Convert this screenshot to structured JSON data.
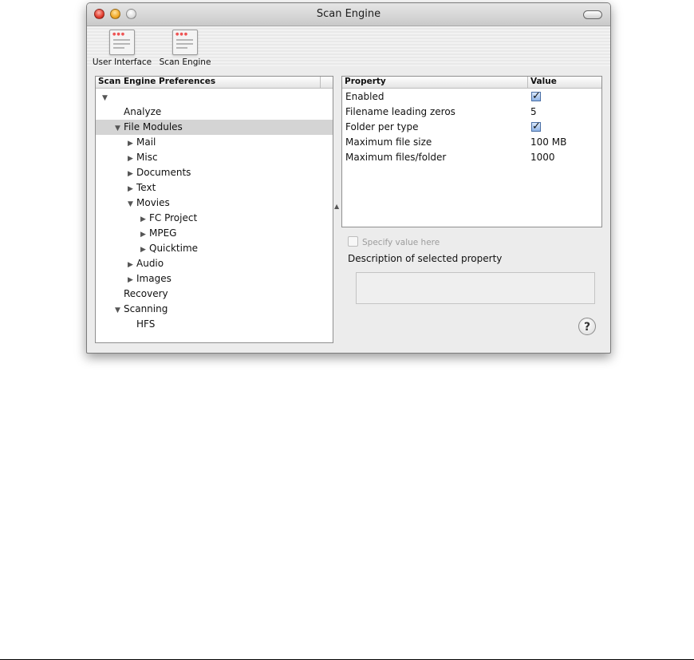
{
  "window": {
    "title": "Scan Engine"
  },
  "toolbar": {
    "items": [
      {
        "label": "User Interface",
        "icon": "window-prefs-icon"
      },
      {
        "label": "Scan Engine",
        "icon": "window-prefs-icon"
      }
    ]
  },
  "tree": {
    "header": "Scan Engine Preferences",
    "selected": "File Modules",
    "rows": [
      {
        "label": "",
        "expanded": true,
        "depth": 0
      },
      {
        "label": "Analyze",
        "depth": 1
      },
      {
        "label": "File Modules",
        "expanded": true,
        "depth": 1
      },
      {
        "label": "Mail",
        "expanded": false,
        "depth": 2
      },
      {
        "label": "Misc",
        "expanded": false,
        "depth": 2
      },
      {
        "label": "Documents",
        "expanded": false,
        "depth": 2
      },
      {
        "label": "Text",
        "expanded": false,
        "depth": 2
      },
      {
        "label": "Movies",
        "expanded": true,
        "depth": 2
      },
      {
        "label": "FC Project",
        "expanded": false,
        "depth": 3
      },
      {
        "label": "MPEG",
        "expanded": false,
        "depth": 3
      },
      {
        "label": "Quicktime",
        "expanded": false,
        "depth": 3
      },
      {
        "label": "Audio",
        "expanded": false,
        "depth": 2
      },
      {
        "label": "Images",
        "expanded": false,
        "depth": 2
      },
      {
        "label": "Recovery",
        "depth": 1
      },
      {
        "label": "Scanning",
        "expanded": true,
        "depth": 1
      },
      {
        "label": "HFS",
        "depth": 2
      }
    ]
  },
  "properties": {
    "header_property": "Property",
    "header_value": "Value",
    "rows": [
      {
        "name": "Enabled",
        "value": "",
        "checked": true
      },
      {
        "name": "Filename leading zeros",
        "value": "5"
      },
      {
        "name": "Folder per type",
        "value": "",
        "checked": true
      },
      {
        "name": "Maximum file size",
        "value": "100 MB"
      },
      {
        "name": "Maximum files/folder",
        "value": "1000"
      }
    ]
  },
  "specify_value_label": "Specify value here",
  "description_label": "Description of selected property",
  "help_label": "?",
  "colors": {
    "selection": "#d4d4d4",
    "checkbox": "#8fb4e6"
  }
}
